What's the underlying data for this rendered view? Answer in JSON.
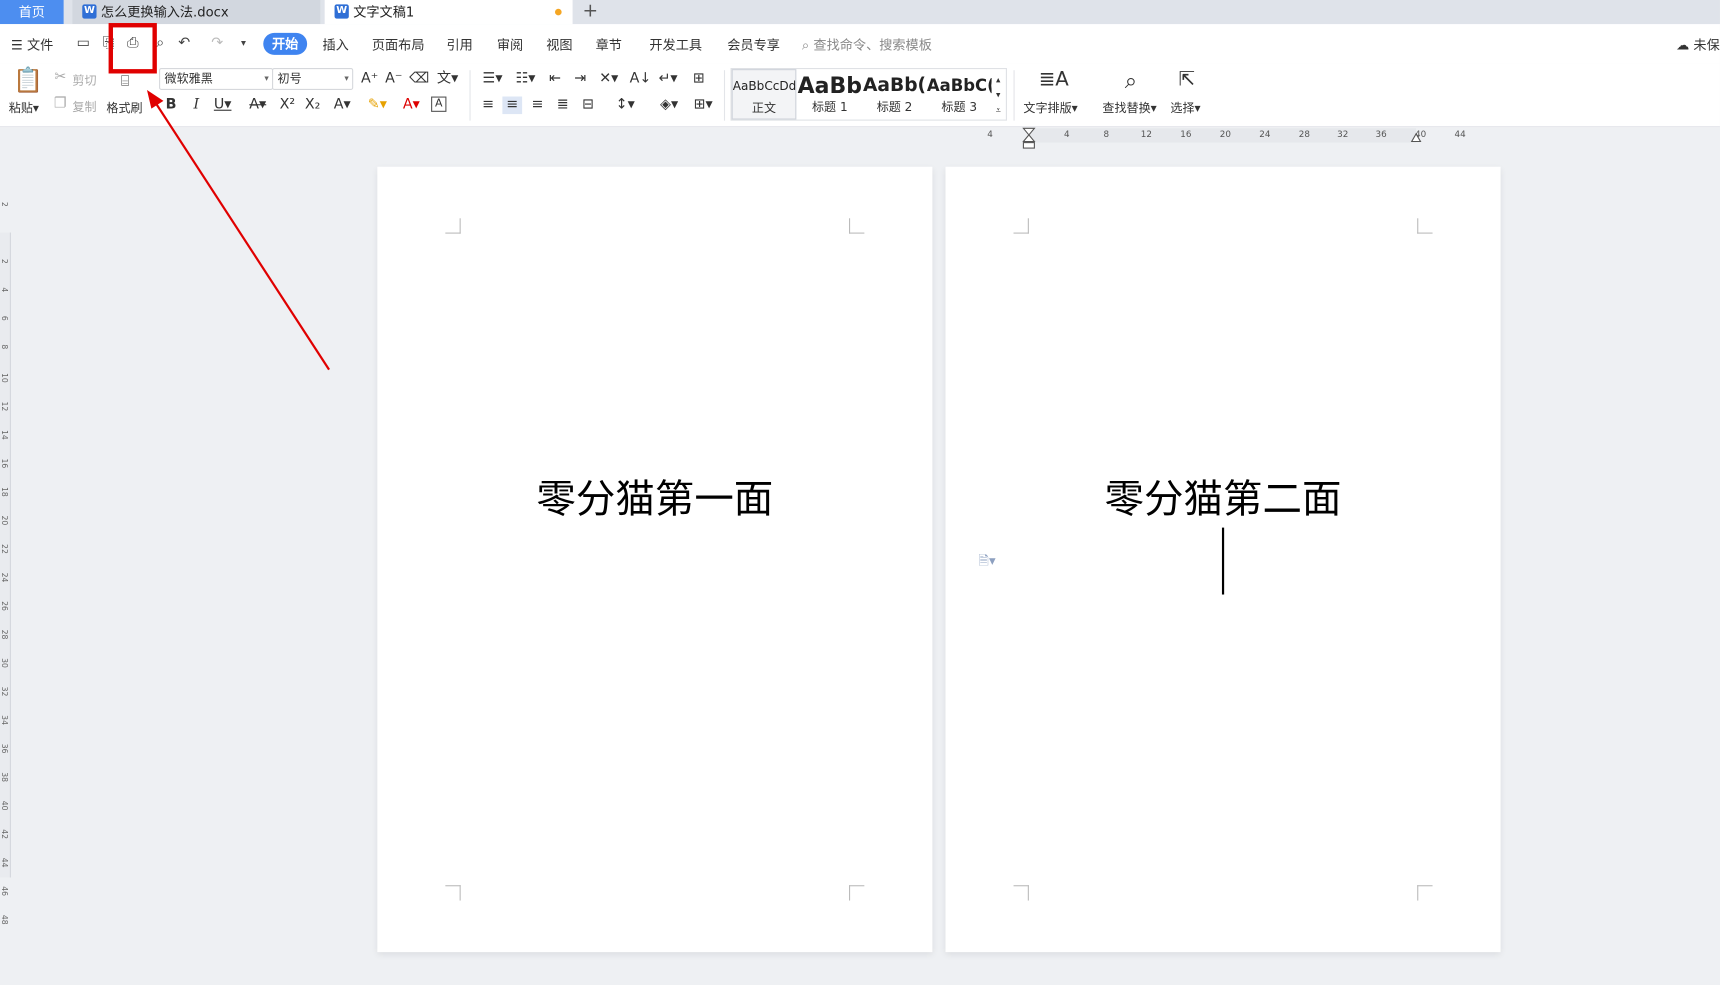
{
  "tabs": {
    "home": "首页",
    "doc1": "怎么更换输入法.docx",
    "doc2": "文字文稿1",
    "new_tab": "+"
  },
  "menubar": {
    "file": "文件",
    "start": "开始",
    "items": [
      "插入",
      "页面布局",
      "引用",
      "审阅",
      "视图",
      "章节",
      "开发工具",
      "会员专享"
    ],
    "search_placeholder": "查找命令、搜索模板",
    "cloud": "未保"
  },
  "ribbon": {
    "paste": "粘贴",
    "cut": "剪切",
    "copy": "复制",
    "format_painter": "格式刷",
    "font_name": "微软雅黑",
    "font_size": "初号",
    "styles": [
      {
        "preview": "AaBbCcDd",
        "name": "正文"
      },
      {
        "preview": "AaBb",
        "name": "标题 1"
      },
      {
        "preview": "AaBb(",
        "name": "标题 2"
      },
      {
        "preview": "AaBbC(",
        "name": "标题 3"
      }
    ],
    "text_layout": "文字排版",
    "find_replace": "查找替换",
    "select": "选择"
  },
  "ruler_h": [
    "4",
    "4",
    "8",
    "12",
    "16",
    "20",
    "24",
    "28",
    "32",
    "36",
    "40",
    "44"
  ],
  "ruler_v": [
    "2",
    "2",
    "4",
    "6",
    "8",
    "10",
    "12",
    "14",
    "16",
    "18",
    "20",
    "22",
    "24",
    "26",
    "28",
    "30",
    "32",
    "34",
    "36",
    "38",
    "40",
    "42",
    "44",
    "46",
    "48"
  ],
  "pages": [
    {
      "text": "零分猫第一面"
    },
    {
      "text": "零分猫第二面"
    }
  ],
  "colors": {
    "accent": "#3f84f0",
    "annotation": "#e00000",
    "tab_home": "#4d8ef0"
  }
}
